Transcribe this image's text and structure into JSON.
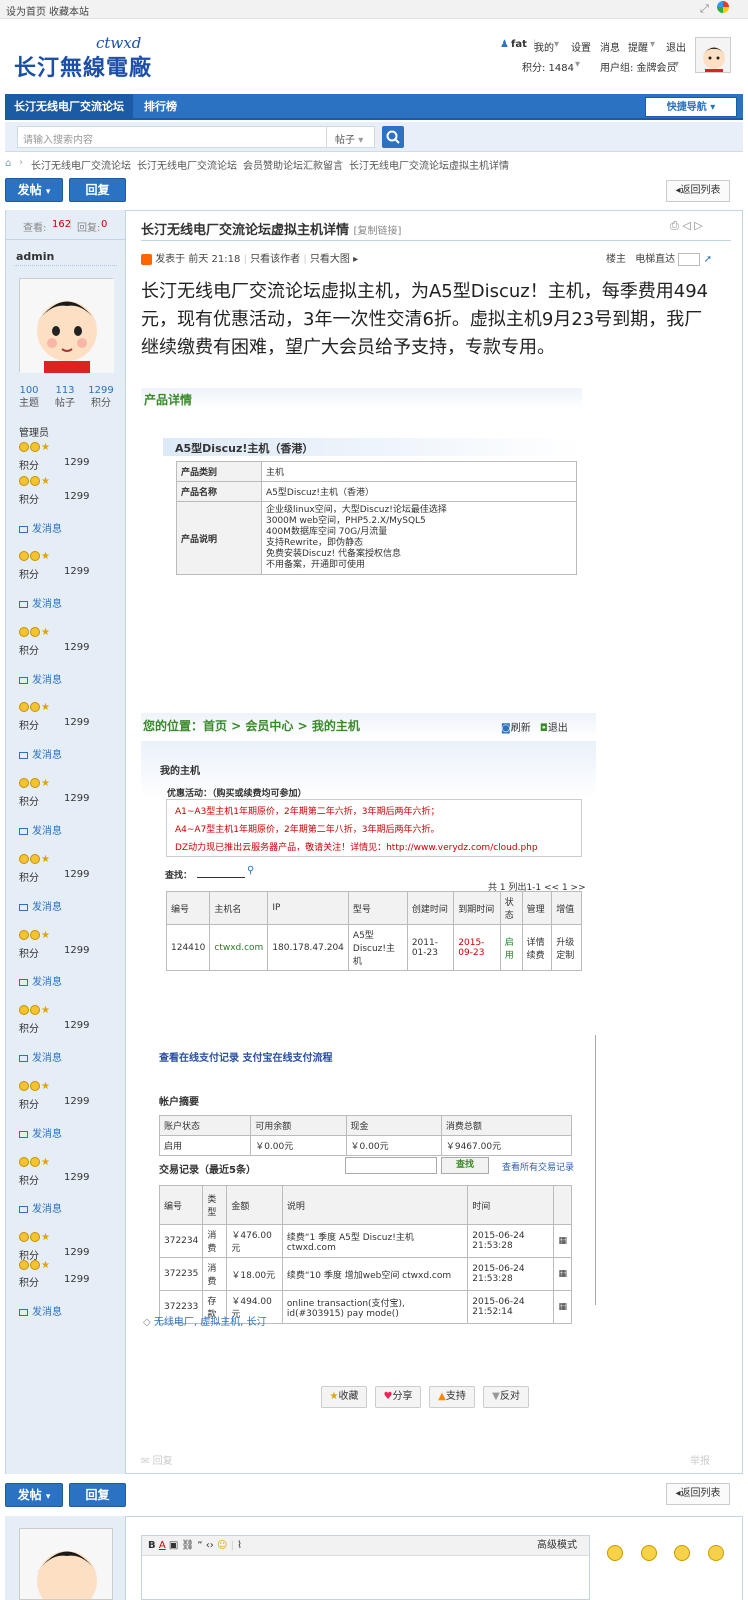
{
  "topbar": {
    "set_home": "设为首页",
    "bookmark": "收藏本站"
  },
  "logo": {
    "text": "长汀無線電廠",
    "sub": "ctwxd"
  },
  "user": {
    "name": "fat",
    "my": "我的",
    "settings": "设置",
    "messages": "消息",
    "reminders": "提醒",
    "logout": "退出",
    "points": "积分: 1484",
    "group": "用户组: 金牌会员"
  },
  "nav": {
    "items": [
      "长汀无线电厂交流论坛",
      "排行榜"
    ],
    "quick": "快捷导航"
  },
  "search": {
    "placeholder": "请输入搜索内容",
    "type": "帖子"
  },
  "breadcrumb": [
    "长汀无线电厂交流论坛",
    "长汀无线电厂交流论坛",
    "会员赞助论坛汇款留言",
    "长汀无线电厂交流论坛虚拟主机详情"
  ],
  "actions": {
    "post": "发帖",
    "reply": "回复",
    "back": "返回列表"
  },
  "thread": {
    "views_label": "查看:",
    "views": "162",
    "replies_label": "回复:",
    "replies": "0",
    "title": "长汀无线电厂交流论坛虚拟主机详情",
    "copy_link": "[复制链接]",
    "posted": "发表于 前天 21:18",
    "only_author": "只看该作者",
    "only_image": "只看大图",
    "floor": "楼主",
    "goto_floor": "电梯直达",
    "body": "长汀无线电厂交流论坛虚拟主机，为A5型Discuz！主机，每季费用494元，现有优惠活动，3年一次性交清6折。虚拟主机9月23号到期，我厂继续缴费有困难，望广大会员给予支持，专款专用。",
    "tags": "无线电厂, 虚拟主机, 长汀"
  },
  "author": {
    "name": "admin",
    "stats": [
      {
        "v": "100",
        "l": "主题"
      },
      {
        "v": "113",
        "l": "帖子"
      },
      {
        "v": "1299",
        "l": "积分"
      }
    ],
    "group": "管理员",
    "points_label": "积分",
    "points": "1299",
    "msg": "发消息"
  },
  "product": {
    "section": "产品详情",
    "name": "A5型Discuz!主机（香港）",
    "rows": [
      {
        "k": "产品类别",
        "v": "主机"
      },
      {
        "k": "产品名称",
        "v": "A5型Discuz!主机（香港）"
      }
    ],
    "desc_label": "产品说明",
    "desc": [
      "企业级linux空间，大型Discuz!论坛最佳选择",
      "3000M web空间，PHP5.2.X/MySQL5",
      "400M数据库空间 70G/月流量",
      "支持Rewrite，即伪静态",
      "免费安装Discuz! 代备案授权信息",
      "不用备案，开通即可使用"
    ]
  },
  "host": {
    "location": "您的位置：首页 > 会员中心 > 我的主机",
    "refresh": "刷新",
    "exit": "退出",
    "title": "我的主机",
    "promo_title": "优惠活动：（购买或续费均可参加）",
    "promos": [
      "A1~A3型主机1年期原价，2年期第二年六折，3年期后两年六折；",
      "A4~A7型主机1年期原价，2年期第二年八折，3年期后两年六折。",
      "DZ动力现已推出云服务器产品，敬请关注！详情见：http://www.verydz.com/cloud.php"
    ],
    "find": "查找：",
    "pager": "共 1 列出1-1 << 1 >>",
    "headers": [
      "编号",
      "主机名",
      "IP",
      "型号",
      "创建时间",
      "到期时间",
      "状态",
      "管理",
      "增值"
    ],
    "row": [
      "124410",
      "ctwxd.com",
      "180.178.47.204",
      "A5型Discuz!主机",
      "2011-01-23",
      "2015-09-23",
      "启用",
      "详情续费",
      "升级定制"
    ]
  },
  "pay": {
    "links": "查看在线支付记录 支付宝在线支付流程",
    "summary_title": "帐户摘要",
    "summary_headers": [
      "账户状态",
      "可用余额",
      "现金",
      "消费总额"
    ],
    "summary_row": [
      "启用",
      "￥0.00元",
      "￥0.00元",
      "￥9467.00元"
    ],
    "records_title": "交易记录（最近5条）",
    "search_btn": "查找",
    "all_records": "查看所有交易记录",
    "headers": [
      "编号",
      "类型",
      "金额",
      "说明",
      "时间",
      ""
    ],
    "rows": [
      [
        "372234",
        "消费",
        "￥476.00元",
        "续费“1 季度 A5型 Discuz!主机 ctwxd.com",
        "2015-06-24 21:53:28"
      ],
      [
        "372235",
        "消费",
        "￥18.00元",
        "续费“10 季度 增加web空间 ctwxd.com",
        "2015-06-24 21:53:28"
      ],
      [
        "372233",
        "存款",
        "￥494.00元",
        "online transaction(支付宝), id(#303915) pay mode()",
        "2015-06-24 21:52:14"
      ]
    ]
  },
  "post_actions": {
    "fav": "收藏",
    "share": "分享",
    "support": "支持",
    "oppose": "反对"
  },
  "footer_post": {
    "report": "回复",
    "report2": "举报"
  },
  "editor": {
    "advanced": "高级模式",
    "tools": "B  A  ▣  ◈  “  ‹›  ☺  |  ⌂"
  },
  "colors": {
    "nav": "#2b72c3",
    "leftbg": "#e5edf6",
    "border": "#c2d5e3",
    "red": "#c00"
  }
}
